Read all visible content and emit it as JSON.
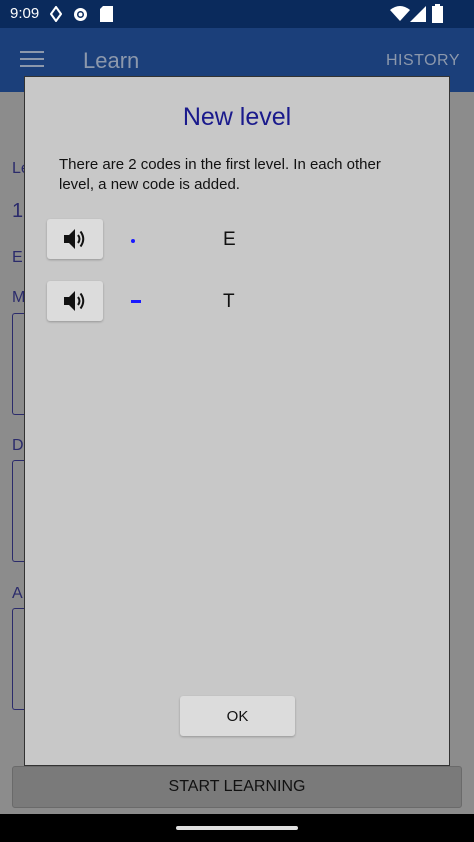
{
  "status_bar": {
    "time": "9:09"
  },
  "app_bar": {
    "title": "Learn",
    "history_label": "HISTORY"
  },
  "background": {
    "fragments": [
      "Le",
      "1",
      "E",
      "M",
      "D",
      "A"
    ],
    "start_button_label": "START LEARNING"
  },
  "dialog": {
    "title": "New level",
    "message": "There are 2 codes in the first level. In each other level, a new code is added.",
    "codes": [
      {
        "morse": "dot",
        "letter": "E"
      },
      {
        "morse": "dash",
        "letter": "T"
      }
    ],
    "ok_label": "OK",
    "accent_color": "#1a1a8c",
    "morse_color": "#1a1aff"
  }
}
